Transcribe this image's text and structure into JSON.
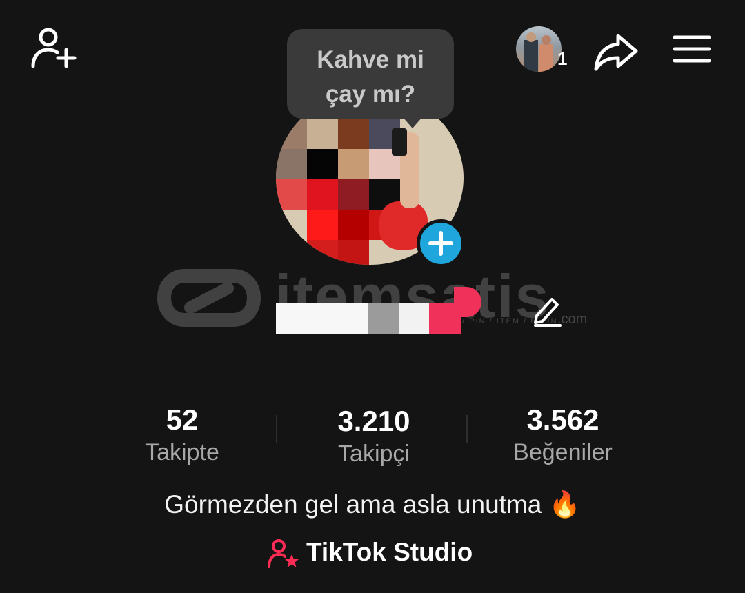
{
  "header": {
    "account_badge_count": "1",
    "note_text": "Kahve mi\nçay mı?"
  },
  "icons": {
    "add_friend": "person-plus-icon",
    "share": "share-arrow-icon",
    "menu": "hamburger-menu-icon",
    "avatar_add": "plus-icon",
    "edit": "pencil-icon",
    "studio": "person-star-icon"
  },
  "watermark": {
    "text": "itemsatis",
    "subtext": "HESAP / PIN / ITEM / E-PIN",
    "domain": ".com"
  },
  "stats": [
    {
      "value": "52",
      "label": "Takipte"
    },
    {
      "value": "3.210",
      "label": "Takipçi"
    },
    {
      "value": "3.562",
      "label": "Beğeniler"
    }
  ],
  "bio": "Görmezden gel ama asla unutma 🔥",
  "studio": {
    "label": "TikTok Studio"
  },
  "colors": {
    "background": "#141414",
    "accent_blue": "#1ea6dd",
    "accent_pink": "#fe2c55",
    "muted_text": "#a8a8a8"
  }
}
